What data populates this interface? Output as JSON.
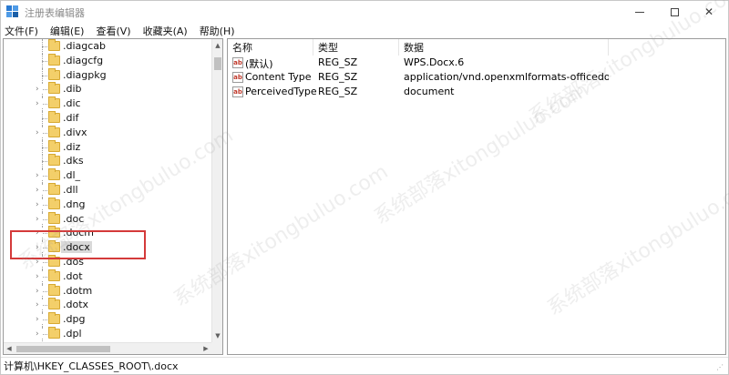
{
  "window": {
    "title": "注册表编辑器"
  },
  "menu": [
    "文件(F)",
    "编辑(E)",
    "查看(V)",
    "收藏夹(A)",
    "帮助(H)"
  ],
  "tree": {
    "items": [
      {
        "label": ".diagcab",
        "expandable": false
      },
      {
        "label": ".diagcfg",
        "expandable": false
      },
      {
        "label": ".diagpkg",
        "expandable": false
      },
      {
        "label": ".dib",
        "expandable": true
      },
      {
        "label": ".dic",
        "expandable": true
      },
      {
        "label": ".dif",
        "expandable": false
      },
      {
        "label": ".divx",
        "expandable": true
      },
      {
        "label": ".diz",
        "expandable": false
      },
      {
        "label": ".dks",
        "expandable": false
      },
      {
        "label": ".dl_",
        "expandable": true
      },
      {
        "label": ".dll",
        "expandable": true
      },
      {
        "label": ".dng",
        "expandable": true
      },
      {
        "label": ".doc",
        "expandable": true
      },
      {
        "label": ".docm",
        "expandable": true
      },
      {
        "label": ".docx",
        "expandable": true,
        "selected": true
      },
      {
        "label": ".dos",
        "expandable": true
      },
      {
        "label": ".dot",
        "expandable": true
      },
      {
        "label": ".dotm",
        "expandable": true
      },
      {
        "label": ".dotx",
        "expandable": true
      },
      {
        "label": ".dpg",
        "expandable": true
      },
      {
        "label": ".dpl",
        "expandable": true
      }
    ]
  },
  "values": {
    "headers": {
      "name": "名称",
      "type": "类型",
      "data": "数据"
    },
    "rows": [
      {
        "icon": "ab",
        "name": "(默认)",
        "type": "REG_SZ",
        "data": "WPS.Docx.6"
      },
      {
        "icon": "ab",
        "name": "Content Type",
        "type": "REG_SZ",
        "data": "application/vnd.openxmlformats-officedocum..."
      },
      {
        "icon": "ab",
        "name": "PerceivedType",
        "type": "REG_SZ",
        "data": "document"
      }
    ]
  },
  "status": {
    "path": "计算机\\HKEY_CLASSES_ROOT\\.docx"
  },
  "watermark": {
    "text": "系统部落xitongbuluo.com"
  },
  "colors": {
    "highlight": "#d43a3a",
    "folder": "#f3cf6a"
  }
}
